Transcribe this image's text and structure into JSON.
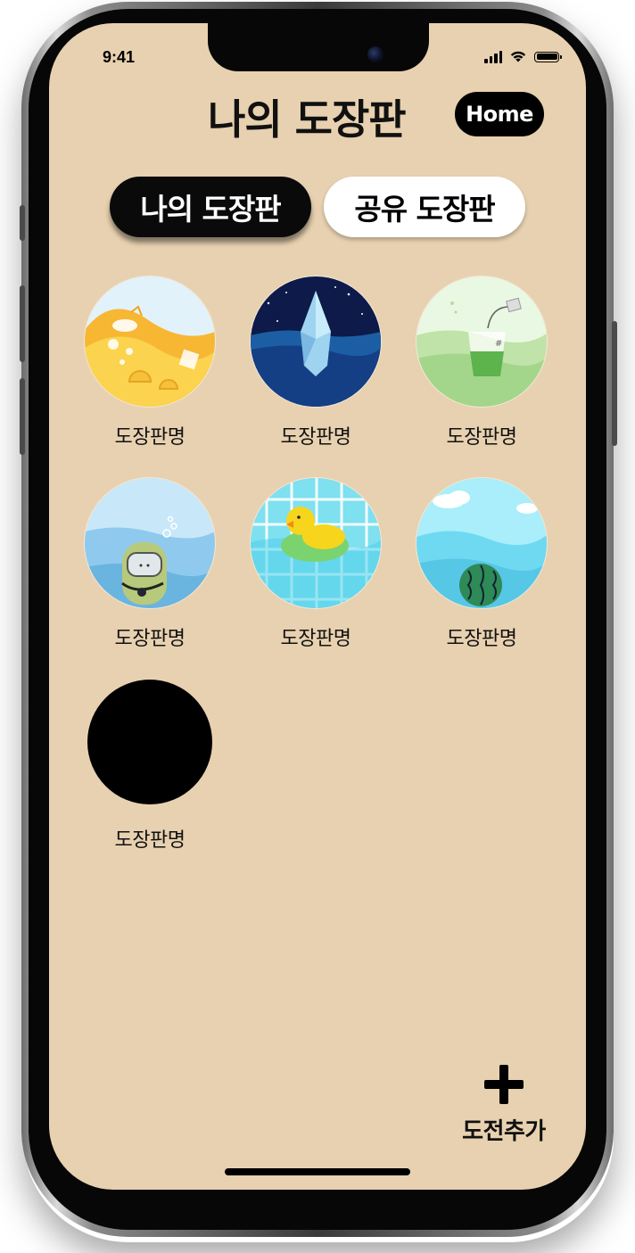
{
  "status_bar": {
    "time": "9:41",
    "icons": [
      "signal-icon",
      "wifi-icon",
      "battery-icon"
    ]
  },
  "header": {
    "title": "나의 도장판",
    "home_button": "Home"
  },
  "tabs": [
    {
      "label": "나의 도장판",
      "selected": true
    },
    {
      "label": "공유 도장판",
      "selected": false
    }
  ],
  "boards": [
    {
      "name": "도장판명",
      "theme": "lemonade"
    },
    {
      "name": "도장판명",
      "theme": "iceberg"
    },
    {
      "name": "도장판명",
      "theme": "green-tea"
    },
    {
      "name": "도장판명",
      "theme": "diver"
    },
    {
      "name": "도장판명",
      "theme": "rubber-duck"
    },
    {
      "name": "도장판명",
      "theme": "watermelon"
    },
    {
      "name": "도장판명",
      "theme": "blank"
    }
  ],
  "add_challenge": {
    "label": "도전추가",
    "icon": "plus-icon"
  },
  "colors": {
    "background": "#e8d1b0",
    "selected_tab": "#0a0a0a",
    "unselected_tab": "#ffffff"
  }
}
